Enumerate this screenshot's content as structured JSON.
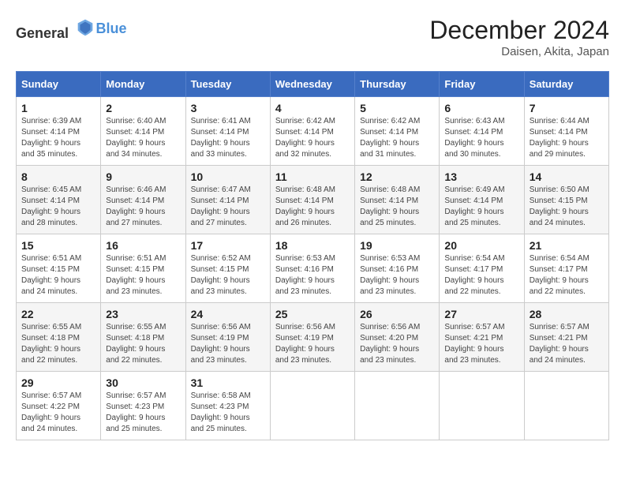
{
  "header": {
    "logo_general": "General",
    "logo_blue": "Blue",
    "month": "December 2024",
    "location": "Daisen, Akita, Japan"
  },
  "days_of_week": [
    "Sunday",
    "Monday",
    "Tuesday",
    "Wednesday",
    "Thursday",
    "Friday",
    "Saturday"
  ],
  "weeks": [
    [
      {
        "day": "1",
        "sunrise": "6:39 AM",
        "sunset": "4:14 PM",
        "daylight": "9 hours and 35 minutes."
      },
      {
        "day": "2",
        "sunrise": "6:40 AM",
        "sunset": "4:14 PM",
        "daylight": "9 hours and 34 minutes."
      },
      {
        "day": "3",
        "sunrise": "6:41 AM",
        "sunset": "4:14 PM",
        "daylight": "9 hours and 33 minutes."
      },
      {
        "day": "4",
        "sunrise": "6:42 AM",
        "sunset": "4:14 PM",
        "daylight": "9 hours and 32 minutes."
      },
      {
        "day": "5",
        "sunrise": "6:42 AM",
        "sunset": "4:14 PM",
        "daylight": "9 hours and 31 minutes."
      },
      {
        "day": "6",
        "sunrise": "6:43 AM",
        "sunset": "4:14 PM",
        "daylight": "9 hours and 30 minutes."
      },
      {
        "day": "7",
        "sunrise": "6:44 AM",
        "sunset": "4:14 PM",
        "daylight": "9 hours and 29 minutes."
      }
    ],
    [
      {
        "day": "8",
        "sunrise": "6:45 AM",
        "sunset": "4:14 PM",
        "daylight": "9 hours and 28 minutes."
      },
      {
        "day": "9",
        "sunrise": "6:46 AM",
        "sunset": "4:14 PM",
        "daylight": "9 hours and 27 minutes."
      },
      {
        "day": "10",
        "sunrise": "6:47 AM",
        "sunset": "4:14 PM",
        "daylight": "9 hours and 27 minutes."
      },
      {
        "day": "11",
        "sunrise": "6:48 AM",
        "sunset": "4:14 PM",
        "daylight": "9 hours and 26 minutes."
      },
      {
        "day": "12",
        "sunrise": "6:48 AM",
        "sunset": "4:14 PM",
        "daylight": "9 hours and 25 minutes."
      },
      {
        "day": "13",
        "sunrise": "6:49 AM",
        "sunset": "4:14 PM",
        "daylight": "9 hours and 25 minutes."
      },
      {
        "day": "14",
        "sunrise": "6:50 AM",
        "sunset": "4:15 PM",
        "daylight": "9 hours and 24 minutes."
      }
    ],
    [
      {
        "day": "15",
        "sunrise": "6:51 AM",
        "sunset": "4:15 PM",
        "daylight": "9 hours and 24 minutes."
      },
      {
        "day": "16",
        "sunrise": "6:51 AM",
        "sunset": "4:15 PM",
        "daylight": "9 hours and 23 minutes."
      },
      {
        "day": "17",
        "sunrise": "6:52 AM",
        "sunset": "4:15 PM",
        "daylight": "9 hours and 23 minutes."
      },
      {
        "day": "18",
        "sunrise": "6:53 AM",
        "sunset": "4:16 PM",
        "daylight": "9 hours and 23 minutes."
      },
      {
        "day": "19",
        "sunrise": "6:53 AM",
        "sunset": "4:16 PM",
        "daylight": "9 hours and 23 minutes."
      },
      {
        "day": "20",
        "sunrise": "6:54 AM",
        "sunset": "4:17 PM",
        "daylight": "9 hours and 22 minutes."
      },
      {
        "day": "21",
        "sunrise": "6:54 AM",
        "sunset": "4:17 PM",
        "daylight": "9 hours and 22 minutes."
      }
    ],
    [
      {
        "day": "22",
        "sunrise": "6:55 AM",
        "sunset": "4:18 PM",
        "daylight": "9 hours and 22 minutes."
      },
      {
        "day": "23",
        "sunrise": "6:55 AM",
        "sunset": "4:18 PM",
        "daylight": "9 hours and 22 minutes."
      },
      {
        "day": "24",
        "sunrise": "6:56 AM",
        "sunset": "4:19 PM",
        "daylight": "9 hours and 23 minutes."
      },
      {
        "day": "25",
        "sunrise": "6:56 AM",
        "sunset": "4:19 PM",
        "daylight": "9 hours and 23 minutes."
      },
      {
        "day": "26",
        "sunrise": "6:56 AM",
        "sunset": "4:20 PM",
        "daylight": "9 hours and 23 minutes."
      },
      {
        "day": "27",
        "sunrise": "6:57 AM",
        "sunset": "4:21 PM",
        "daylight": "9 hours and 23 minutes."
      },
      {
        "day": "28",
        "sunrise": "6:57 AM",
        "sunset": "4:21 PM",
        "daylight": "9 hours and 24 minutes."
      }
    ],
    [
      {
        "day": "29",
        "sunrise": "6:57 AM",
        "sunset": "4:22 PM",
        "daylight": "9 hours and 24 minutes."
      },
      {
        "day": "30",
        "sunrise": "6:57 AM",
        "sunset": "4:23 PM",
        "daylight": "9 hours and 25 minutes."
      },
      {
        "day": "31",
        "sunrise": "6:58 AM",
        "sunset": "4:23 PM",
        "daylight": "9 hours and 25 minutes."
      },
      null,
      null,
      null,
      null
    ]
  ]
}
